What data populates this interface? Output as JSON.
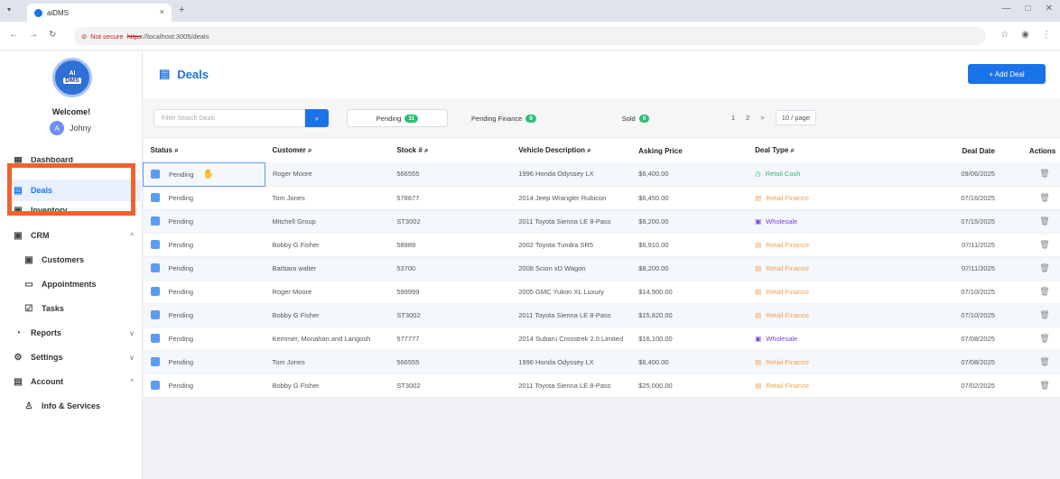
{
  "browser": {
    "tab_title": "aiDMS",
    "tab_close": "×",
    "new_tab": "+",
    "url_warning": "Not secure",
    "url_proto": "https",
    "url_rest": "://localhost:3005/deals",
    "window_controls": [
      "—",
      "□",
      "✕"
    ]
  },
  "sidebar": {
    "logo_line1": "AI",
    "logo_line2": "DMS",
    "welcome": "Welcome!",
    "user_initial": "A",
    "user_name": "Johny",
    "items": [
      {
        "label": "Dashboard",
        "icon": "dashboard-icon"
      },
      {
        "label": "Deals",
        "icon": "deals-icon"
      },
      {
        "label": "Inventory",
        "icon": "inventory-icon"
      },
      {
        "label": "CRM",
        "icon": "crm-icon",
        "chevron": "^"
      },
      {
        "label": "Customers",
        "icon": "customers-icon"
      },
      {
        "label": "Appointments",
        "icon": "calendar-icon"
      },
      {
        "label": "Tasks",
        "icon": "tasks-icon"
      },
      {
        "label": "Reports",
        "icon": "reports-icon",
        "chevron": "v"
      },
      {
        "label": "Settings",
        "icon": "gear-icon",
        "chevron": "v"
      },
      {
        "label": "Account",
        "icon": "account-icon",
        "chevron": "^"
      },
      {
        "label": "Info & Services",
        "icon": "info-icon"
      }
    ]
  },
  "header": {
    "title": "Deals",
    "add_button": "+ Add Deal"
  },
  "filters": {
    "search_placeholder": "Filter Search Deals",
    "pending_label": "Pending",
    "pending_count": "11",
    "pending_finance_label": "Pending Finance",
    "pending_finance_count": "0",
    "sold_label": "Sold",
    "sold_count": "0",
    "pager_pages": [
      "1",
      "2",
      ">"
    ],
    "page_size": "10 / page"
  },
  "table": {
    "columns": [
      "Status",
      "Customer",
      "Stock #",
      "Vehicle Description",
      "Asking Price",
      "Deal Type",
      "Deal Date",
      "Actions"
    ],
    "rows": [
      {
        "status": "Pending",
        "customer": "Roger Moore",
        "stock": "566555",
        "vehicle": "1996 Honda Odyssey LX",
        "price": "$6,400.00",
        "deal_type": "Retail Cash",
        "type_class": "cash",
        "date": "09/06/2025"
      },
      {
        "status": "Pending",
        "customer": "Tom Jones",
        "stock": "578677",
        "vehicle": "2014 Jeep Wrangler Rubicon",
        "price": "$6,450.00",
        "deal_type": "Retail Finance",
        "type_class": "finance",
        "date": "07/16/2025"
      },
      {
        "status": "Pending",
        "customer": "Mitchell Group",
        "stock": "ST3002",
        "vehicle": "2011 Toyota Sienna LE 8-Pass",
        "price": "$6,200.00",
        "deal_type": "Wholesale",
        "type_class": "wholesale",
        "date": "07/15/2025"
      },
      {
        "status": "Pending",
        "customer": "Bobby G Fisher",
        "stock": "58989",
        "vehicle": "2002 Toyota Tundra SR5",
        "price": "$6,910.00",
        "deal_type": "Retail Finance",
        "type_class": "finance",
        "date": "07/11/2025"
      },
      {
        "status": "Pending",
        "customer": "Barbara walter",
        "stock": "53700",
        "vehicle": "2008 Scion xD Wagon",
        "price": "$8,200.00",
        "deal_type": "Retail Finance",
        "type_class": "finance",
        "date": "07/11/2025"
      },
      {
        "status": "Pending",
        "customer": "Roger Moore",
        "stock": "599999",
        "vehicle": "2005 GMC Yukon XL Luxury",
        "price": "$14,900.00",
        "deal_type": "Retail Finance",
        "type_class": "finance",
        "date": "07/10/2025"
      },
      {
        "status": "Pending",
        "customer": "Bobby G Fisher",
        "stock": "ST3002",
        "vehicle": "2011 Toyota Sienna LE 8-Pass",
        "price": "$15,820.00",
        "deal_type": "Retail Finance",
        "type_class": "finance",
        "date": "07/10/2025"
      },
      {
        "status": "Pending",
        "customer": "Kemmer, Monahan and Langosh",
        "stock": "577777",
        "vehicle": "2014 Subaru Crosstrek 2.0 Limited",
        "price": "$16,100.00",
        "deal_type": "Wholesale",
        "type_class": "wholesale",
        "date": "07/08/2025"
      },
      {
        "status": "Pending",
        "customer": "Tom Jones",
        "stock": "566555",
        "vehicle": "1996 Honda Odyssey LX",
        "price": "$6,400.00",
        "deal_type": "Retail Finance",
        "type_class": "finance",
        "date": "07/08/2025"
      },
      {
        "status": "Pending",
        "customer": "Bobby G Fisher",
        "stock": "ST3002",
        "vehicle": "2011 Toyota Sienna LE 8-Pass",
        "price": "$25,000.00",
        "deal_type": "Retail Finance",
        "type_class": "finance",
        "date": "07/02/2025"
      }
    ]
  }
}
